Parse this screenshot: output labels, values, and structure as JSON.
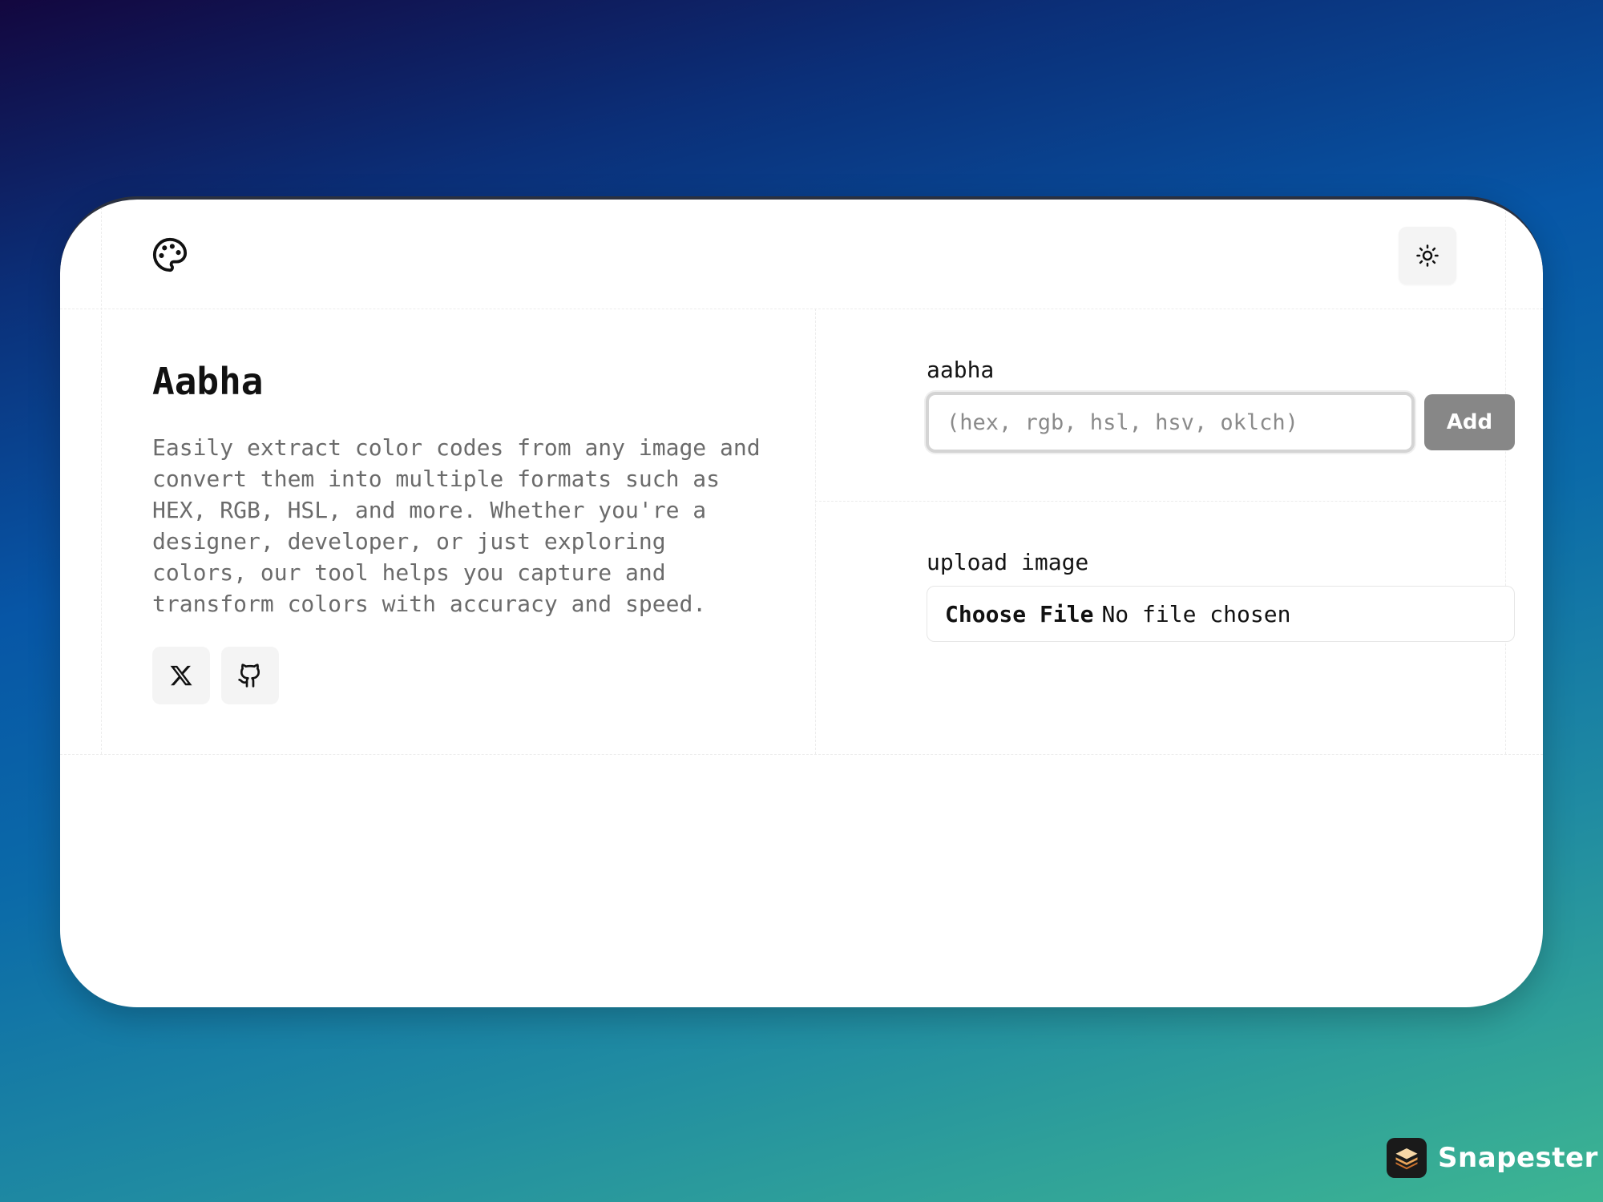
{
  "header": {
    "logo_icon": "palette-icon",
    "theme_toggle_icon": "sun-icon"
  },
  "intro": {
    "title": "Aabha",
    "description": "Easily extract color codes from any image and convert them into multiple formats such as HEX, RGB, HSL, and more. Whether you're a designer, developer, or just exploring colors, our tool helps you capture and transform colors with accuracy and speed.",
    "social_icons": [
      "x-icon",
      "github-icon"
    ]
  },
  "color_form": {
    "label": "aabha",
    "input_value": "",
    "placeholder": "(hex, rgb, hsl, hsv, oklch)",
    "add_label": "Add",
    "add_color": "#878787"
  },
  "upload": {
    "label": "upload image",
    "choose_label": "Choose File",
    "status": "No file chosen"
  },
  "branding": {
    "name": "Snapester"
  }
}
